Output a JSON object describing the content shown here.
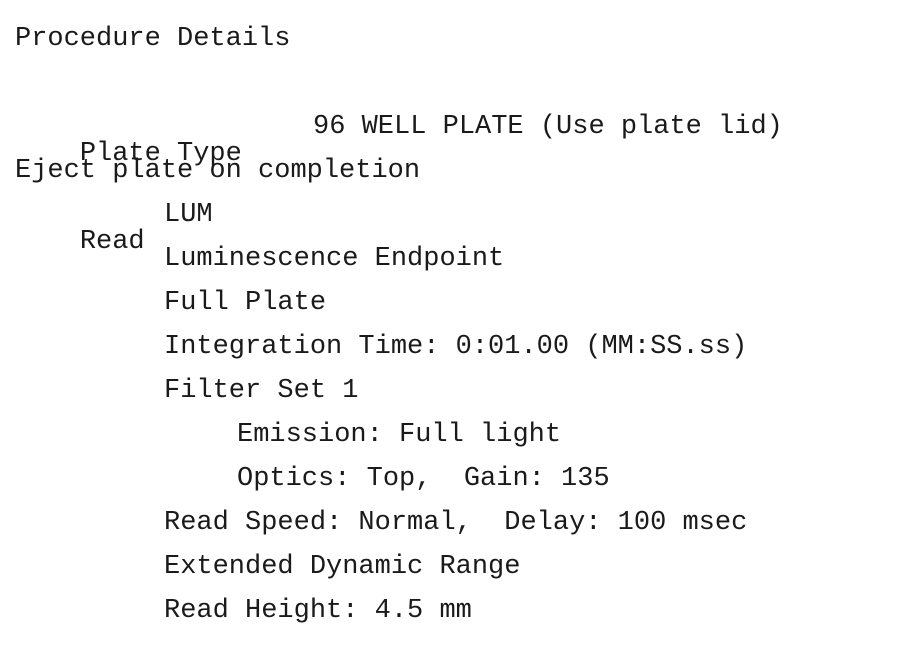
{
  "title": "Procedure Details",
  "plate_type": {
    "label": "Plate Type",
    "value": "96 WELL PLATE (Use plate lid)"
  },
  "eject": "Eject plate on completion",
  "read": {
    "label": "Read",
    "mode": "LUM",
    "method": "Luminescence Endpoint",
    "area": "Full Plate",
    "integration_time": "Integration Time: 0:01.00 (MM:SS.ss)",
    "filter_set": "Filter Set 1",
    "emission": "Emission: Full light",
    "optics_gain": "Optics: Top,  Gain: 135",
    "speed_delay": "Read Speed: Normal,  Delay: 100 msec",
    "dynamic_range": "Extended Dynamic Range",
    "read_height": "Read Height: 4.5 mm"
  }
}
